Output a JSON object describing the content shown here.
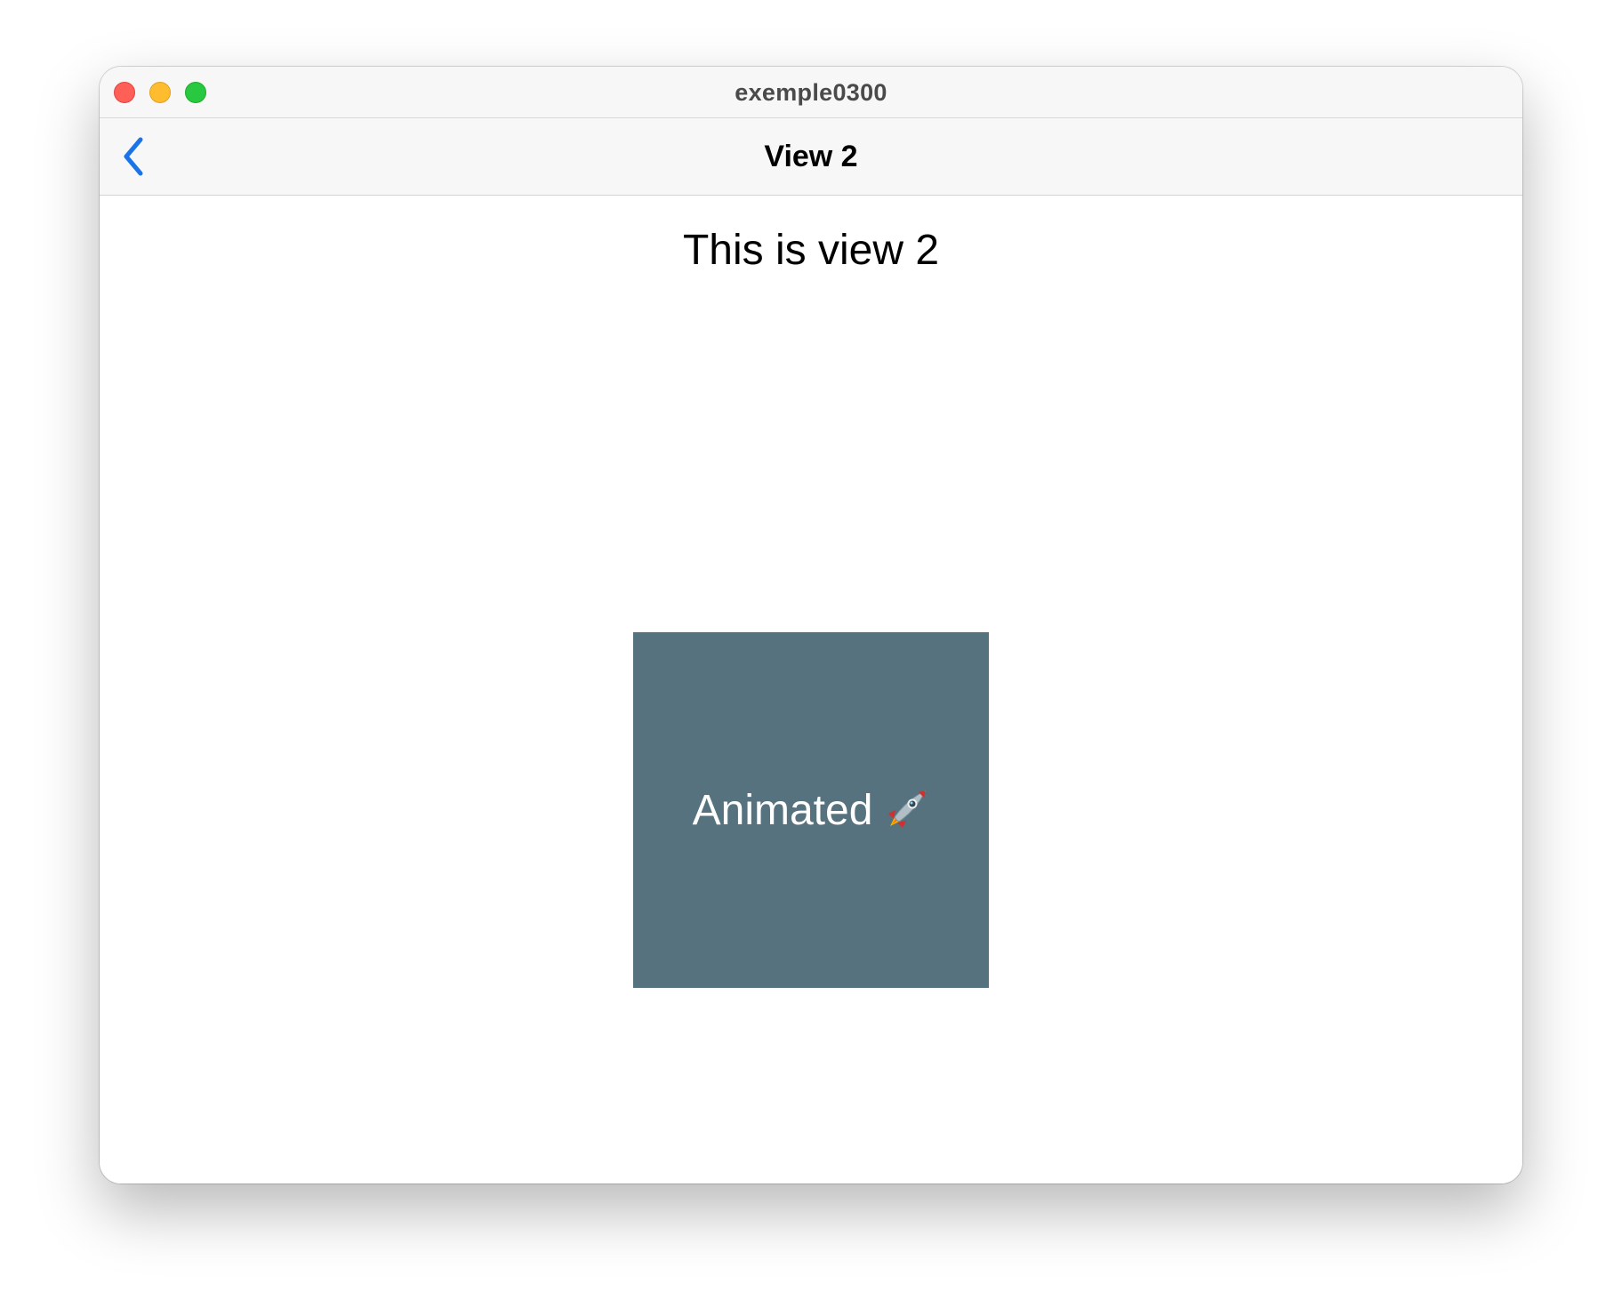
{
  "window": {
    "title": "exemple0300"
  },
  "navbar": {
    "title": "View 2",
    "back_icon": "chevron-left-icon",
    "accent_color": "#1a73e8"
  },
  "content": {
    "heading": "This is view 2",
    "box": {
      "label": "Animated",
      "icon": "rocket-icon",
      "color": "#56727f"
    }
  }
}
